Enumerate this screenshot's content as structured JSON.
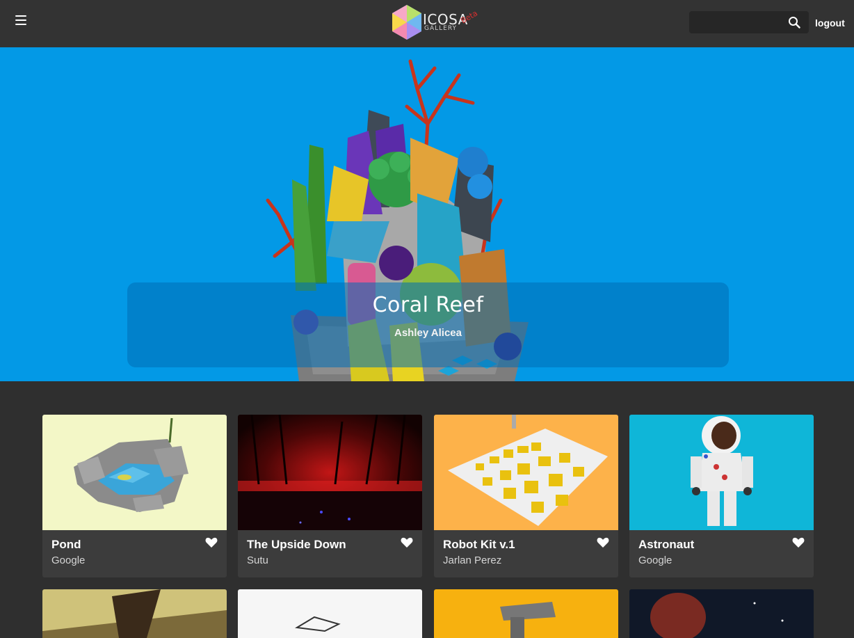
{
  "header": {
    "menu_icon": "hamburger-menu-icon",
    "logo_text": "ICOSA",
    "logo_sub": "GALLERY",
    "logo_badge": "Beta",
    "search_placeholder": "",
    "search_icon": "search-icon",
    "logout_label": "logout"
  },
  "hero": {
    "title": "Coral Reef",
    "author": "Ashley Alicea",
    "background": "#0399e6"
  },
  "cards": [
    {
      "title": "Pond",
      "author": "Google",
      "thumb_bg": "#f3f7c7"
    },
    {
      "title": "The Upside Down",
      "author": "Sutu",
      "thumb_bg": "#1a0606"
    },
    {
      "title": "Robot Kit v.1",
      "author": "Jarlan Perez",
      "thumb_bg": "#fdb24a"
    },
    {
      "title": "Astronaut",
      "author": "Google",
      "thumb_bg": "#0fb6d8"
    }
  ],
  "colors": {
    "topbar": "#333333",
    "page": "#2f2f2f",
    "card": "#3c3c3c",
    "hero": "#0399e6"
  }
}
